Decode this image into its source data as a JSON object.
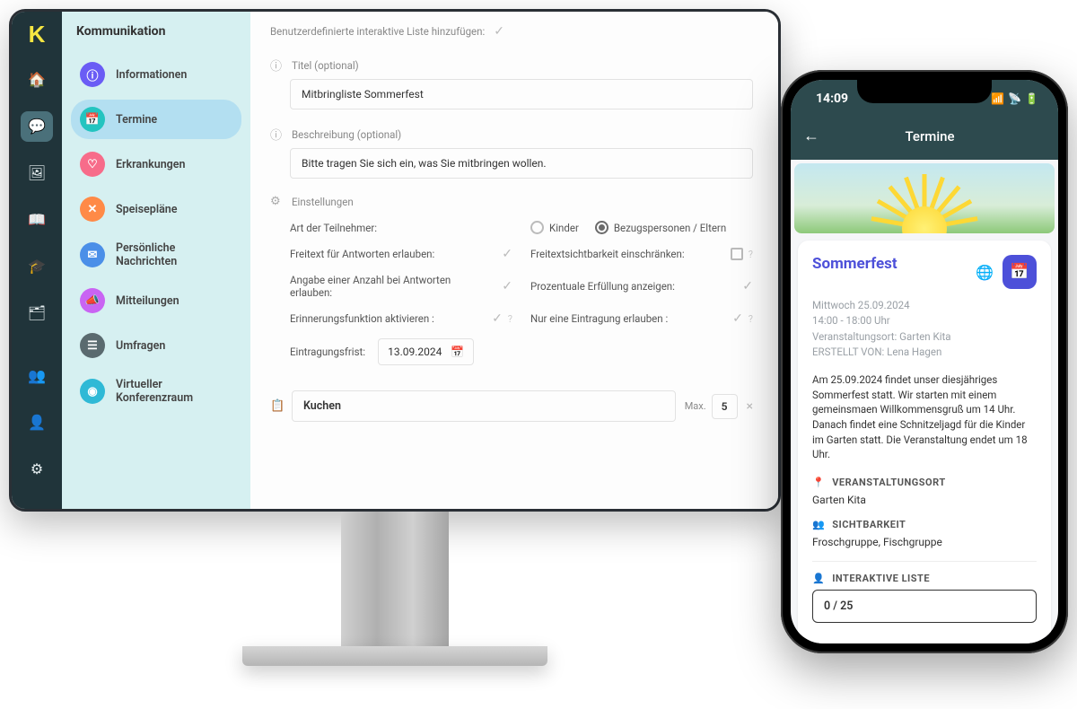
{
  "desktop": {
    "sidebar_title": "Kommunikation",
    "side_items": [
      {
        "label": "Informationen",
        "color": "#6a5cf5"
      },
      {
        "label": "Termine",
        "color": "#24c4c0"
      },
      {
        "label": "Erkrankungen",
        "color": "#f76c8a"
      },
      {
        "label": "Speisepläne",
        "color": "#ff8a47"
      },
      {
        "label": "Persönliche Nachrichten",
        "color": "#4b8fe8"
      },
      {
        "label": "Mitteilungen",
        "color": "#c964f3"
      },
      {
        "label": "Umfragen",
        "color": "#5a6a6f"
      },
      {
        "label": "Virtueller Konferenzraum",
        "color": "#2fb9d6"
      }
    ],
    "main": {
      "header": "Benutzerdefinierte interaktive Liste hinzufügen:",
      "title_label": "Titel (optional)",
      "title_value": "Mitbringliste Sommerfest",
      "desc_label": "Beschreibung (optional)",
      "desc_value": "Bitte tragen Sie sich ein, was Sie mitbringen wollen.",
      "settings_label": "Einstellungen",
      "participant_label": "Art der Teilnehmer:",
      "radio_kinder": "Kinder",
      "radio_parents": "Bezugspersonen / Eltern",
      "opt_freitext": "Freitext für Antworten erlauben:",
      "opt_visibility": "Freitextsichtbarkeit einschränken:",
      "opt_count": "Angabe einer Anzahl bei Antworten erlauben:",
      "opt_percent": "Prozentuale Erfüllung anzeigen:",
      "opt_reminder": "Erinnerungsfunktion aktivieren :",
      "opt_single": "Nur eine Eintragung erlauben :",
      "deadline_label": "Eintragungsfrist:",
      "deadline_value": "13.09.2024",
      "item_value": "Kuchen",
      "max_label": "Max.",
      "max_value": "5"
    }
  },
  "phone": {
    "time": "14:09",
    "header_title": "Termine",
    "card": {
      "title": "Sommerfest",
      "date": "Mittwoch 25.09.2024",
      "time": "14:00 - 18:00 Uhr",
      "location_line": "Veranstaltungsort: Garten Kita",
      "creator_line": "ERSTELLT VON: Lena Hagen",
      "description": "Am 25.09.2024 findet unser diesjähriges Sommerfest statt. Wir starten mit einem gemeinsmaen Willkommensgruß um 14 Uhr. Danach findet eine Schnitzeljagd für die Kinder im Garten statt. Die Veranstaltung endet um 18 Uhr.",
      "sec_location_head": "VERANSTALTUNGSORT",
      "sec_location_body": "Garten Kita",
      "sec_visibility_head": "SICHTBARKEIT",
      "sec_visibility_body": "Froschgruppe, Fischgruppe",
      "sec_list_head": "INTERAKTIVE LISTE",
      "list_progress": "0 / 25"
    }
  }
}
